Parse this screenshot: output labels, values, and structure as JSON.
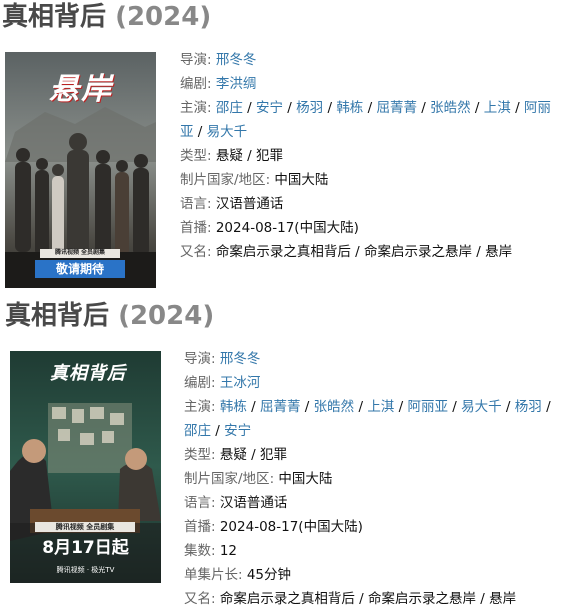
{
  "entries": [
    {
      "title": "真相背后",
      "year": "(2024)",
      "poster": {
        "title_text": "悬岸",
        "small_banner": "腾讯视频 全员剧集",
        "date_text": "敬请期待"
      },
      "director_label": "导演",
      "directors": [
        "邢冬冬"
      ],
      "writer_label": "编剧",
      "writers": [
        "李洪绸"
      ],
      "cast_label": "主演",
      "cast": [
        "邵庄",
        "安宁",
        "杨羽",
        "韩栋",
        "屈菁菁",
        "张皓然",
        "上淇",
        "阿丽亚",
        "易大千"
      ],
      "genre_label": "类型",
      "genre": "悬疑 / 犯罪",
      "region_label": "制片国家/地区",
      "region": "中国大陆",
      "language_label": "语言",
      "language": "汉语普通话",
      "premiere_label": "首播",
      "premiere": "2024-08-17(中国大陆)",
      "aka_label": "又名",
      "aka": "命案启示录之真相背后 / 命案启示录之悬岸 / 悬岸"
    },
    {
      "title": "真相背后",
      "year": "(2024)",
      "poster": {
        "title_text": "真相背后",
        "small_banner": "腾讯视频 全员剧集",
        "date_text": "8月17日起",
        "platform": "腾讯视频 · 极光TV"
      },
      "director_label": "导演",
      "directors": [
        "邢冬冬"
      ],
      "writer_label": "编剧",
      "writers": [
        "王冰河"
      ],
      "cast_label": "主演",
      "cast": [
        "韩栋",
        "屈菁菁",
        "张皓然",
        "上淇",
        "阿丽亚",
        "易大千",
        "杨羽",
        "邵庄",
        "安宁"
      ],
      "genre_label": "类型",
      "genre": "悬疑 / 犯罪",
      "region_label": "制片国家/地区",
      "region": "中国大陆",
      "language_label": "语言",
      "language": "汉语普通话",
      "premiere_label": "首播",
      "premiere": "2024-08-17(中国大陆)",
      "episodes_label": "集数",
      "episodes": "12",
      "runtime_label": "单集片长",
      "runtime": "45分钟",
      "aka_label": "又名",
      "aka": "命案启示录之真相背后 / 命案启示录之悬岸 / 悬岸"
    }
  ],
  "colors": {
    "link": "#3377aa",
    "label": "#666666",
    "title": "#494949",
    "year": "#888888"
  }
}
